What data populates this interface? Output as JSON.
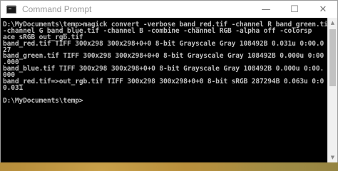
{
  "window": {
    "title": "Command Prompt",
    "controls": {
      "minimize": "—",
      "maximize": "☐",
      "close": "✕"
    }
  },
  "console": {
    "lines": [
      "D:\\MyDocuments\\temp>magick convert -verbose band_red.tif -channel R band_green.tif",
      "-channel G band_blue.tif -channel B -combine -channel RGB -alpha off -colorsp",
      "ace sRGB out_rgb.tif",
      "band_red.tif TIFF 300x298 300x298+0+0 8-bit Grayscale Gray 108492B 0.031u 0:00.0",
      "27",
      "band_green.tif TIFF 300x298 300x298+0+0 8-bit Grayscale Gray 108492B 0.000u 0:00",
      ".000",
      "band_blue.tif TIFF 300x298 300x298+0+0 8-bit Grayscale Gray 108492B 0.000u 0:00.",
      "000",
      "band_red.tif=>out_rgb.tif TIFF 300x298 300x298+0+0 8-bit sRGB 287294B 0.063u 0:0",
      "0.031",
      "",
      "D:\\MyDocuments\\temp>"
    ]
  },
  "scrollbar": {
    "up": "▲",
    "down": "▼"
  }
}
